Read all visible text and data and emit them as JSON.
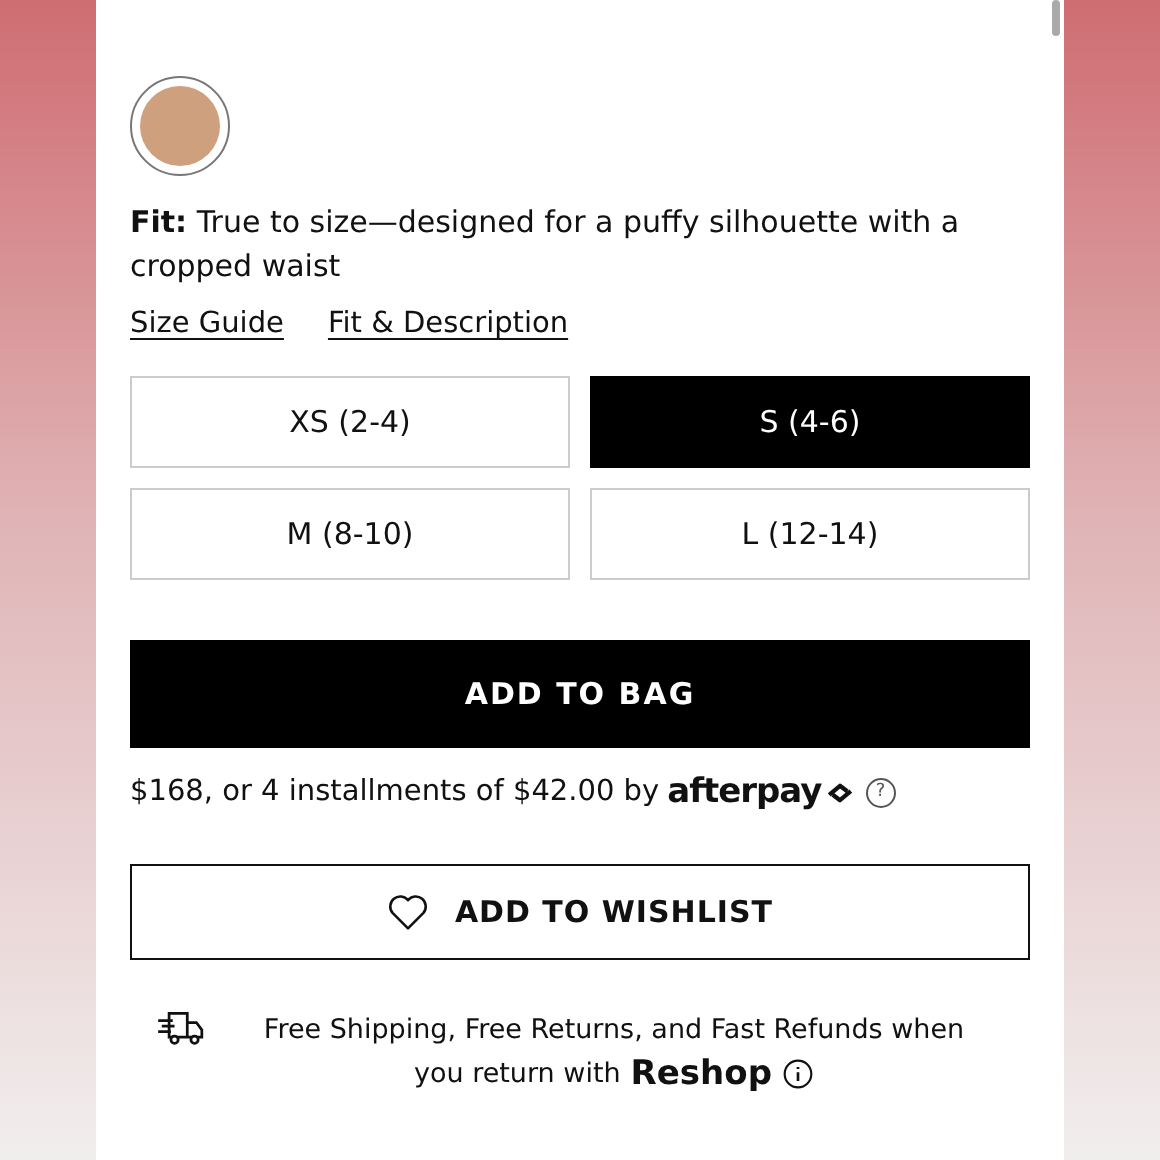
{
  "swatch": {
    "color": "#cfa07e",
    "selected": true
  },
  "fit": {
    "label": "Fit:",
    "text": "True to size—designed for a puffy silhouette with a cropped waist"
  },
  "links": [
    "Size Guide",
    "Fit & Description"
  ],
  "sizes": [
    {
      "label": "XS (2-4)",
      "selected": false
    },
    {
      "label": "S (4-6)",
      "selected": true
    },
    {
      "label": "M (8-10)",
      "selected": false
    },
    {
      "label": "L (12-14)",
      "selected": false
    }
  ],
  "add_button": "ADD TO BAG",
  "installments": {
    "text": "$168, or 4 installments of $42.00 by",
    "brand": "afterpay",
    "help": "?"
  },
  "wishlist_button": "ADD TO WISHLIST",
  "shipping": {
    "lines": [
      "Free Shipping, Free Returns, and Fast Refunds when",
      "you return with"
    ],
    "brand": "Reshop"
  }
}
